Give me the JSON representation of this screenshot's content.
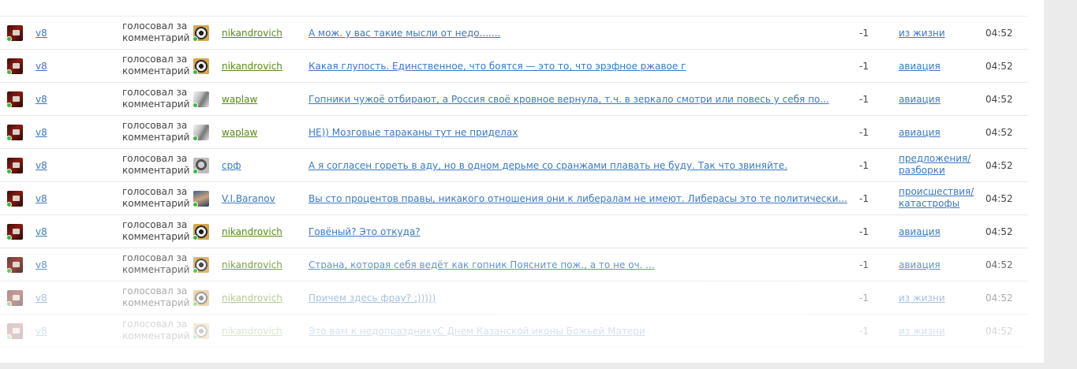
{
  "feed": {
    "rows": [
      {
        "user": "v8",
        "action": "голосовал за комментарий",
        "author": "nikandrovich",
        "author_color": "#5a8a1a",
        "author_avatar": "nikandrovich-avatar",
        "comment": "А мож. у вас такие мысли от недо.......",
        "score": "-1",
        "category": [
          "из жизни"
        ],
        "time": "04:52",
        "opacity": 1
      },
      {
        "user": "v8",
        "action": "голосовал за комментарий",
        "author": "nikandrovich",
        "author_color": "#5a8a1a",
        "author_avatar": "nikandrovich-avatar",
        "comment": "Какая глупость. Единственное, что боятся — это то, что эрэфное ржавое г",
        "score": "-1",
        "category": [
          "авиация"
        ],
        "time": "04:52",
        "opacity": 1
      },
      {
        "user": "v8",
        "action": "голосовал за комментарий",
        "author": "waplaw",
        "author_color": "#5a8a1a",
        "author_avatar": "waplaw-avatar",
        "comment": "Гопники чужоё отбирают, а Россия своё кровное вернула, т.ч. в зеркало смотри или повесь у себя по...",
        "score": "-1",
        "category": [
          "авиация"
        ],
        "time": "04:52",
        "opacity": 1
      },
      {
        "user": "v8",
        "action": "голосовал за комментарий",
        "author": "waplaw",
        "author_color": "#5a8a1a",
        "author_avatar": "waplaw-avatar",
        "comment": "НЕ)) Мозговые тараканы тут не приделах",
        "score": "-1",
        "category": [
          "авиация"
        ],
        "time": "04:52",
        "opacity": 1
      },
      {
        "user": "v8",
        "action": "голосовал за комментарий",
        "author": "срф",
        "author_color": "#3b78c4",
        "author_avatar": "srf-avatar",
        "comment": "А я согласен гореть в аду, но в одном дерьме со сранжами плавать не буду. Так что звиняйте.",
        "score": "-1",
        "category": [
          "предложения/",
          "разборки"
        ],
        "time": "04:52",
        "opacity": 1
      },
      {
        "user": "v8",
        "action": "голосовал за комментарий",
        "author": "V.I.Baranov",
        "author_color": "#3b78c4",
        "author_avatar": "baranov-avatar",
        "comment": "Вы сто процентов  правы, никакого отношения они к либералам не имеют. Либерасы это те политически...",
        "score": "-1",
        "category": [
          "происшествия/",
          "катастрофы"
        ],
        "time": "04:52",
        "opacity": 1
      },
      {
        "user": "v8",
        "action": "голосовал за комментарий",
        "author": "nikandrovich",
        "author_color": "#5a8a1a",
        "author_avatar": "nikandrovich-avatar",
        "comment": "Говёный? Это откуда?",
        "score": "-1",
        "category": [
          "авиация"
        ],
        "time": "04:52",
        "opacity": 1
      },
      {
        "user": "v8",
        "action": "голосовал за комментарий",
        "author": "nikandrovich",
        "author_color": "#5a8a1a",
        "author_avatar": "nikandrovich-avatar",
        "comment": "Страна, которая себя ведёт как гопник Поясните пож., а то не оч. ...",
        "score": "-1",
        "category": [
          "авиация"
        ],
        "time": "04:52",
        "opacity": 0.8
      },
      {
        "user": "v8",
        "action": "голосовал за комментарий",
        "author": "nikandrovich",
        "author_color": "#5a8a1a",
        "author_avatar": "nikandrovich-avatar",
        "comment": "Причем здесь фрау? :)))))",
        "score": "-1",
        "category": [
          "из жизни"
        ],
        "time": "04:52",
        "opacity": 0.45
      },
      {
        "user": "v8",
        "action": "голосовал за комментарий",
        "author": "nikandrovich",
        "author_color": "#5a8a1a",
        "author_avatar": "nikandrovich-avatar",
        "comment": "Это вам к недопраздникуС Днем Казанской иконы Божьей Матери",
        "score": "-1",
        "category": [
          "из жизни"
        ],
        "time": "04:52",
        "opacity": 0.22
      }
    ]
  }
}
